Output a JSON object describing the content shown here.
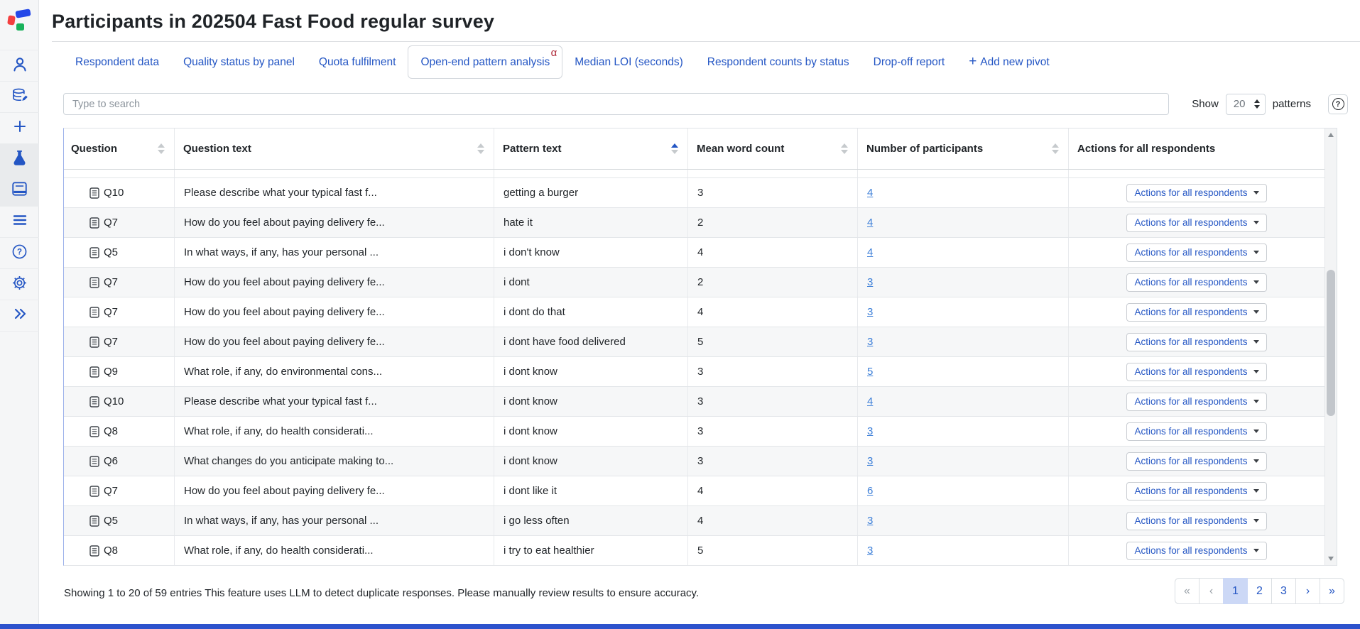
{
  "page": {
    "title": "Participants in 202504 Fast Food regular survey"
  },
  "sidebar": {
    "icons": [
      {
        "name": "user"
      },
      {
        "name": "database"
      },
      {
        "name": "add"
      },
      {
        "name": "flask",
        "active": true
      },
      {
        "name": "book",
        "active": true
      },
      {
        "name": "menu"
      },
      {
        "name": "help"
      },
      {
        "name": "settings"
      },
      {
        "name": "expand"
      }
    ]
  },
  "tabs": [
    {
      "label": "Respondent data"
    },
    {
      "label": "Quality status by panel"
    },
    {
      "label": "Quota fulfilment"
    },
    {
      "label": "Open-end pattern analysis",
      "active": true,
      "badge": "α"
    },
    {
      "label": "Median LOI (seconds)"
    },
    {
      "label": "Respondent counts by status"
    },
    {
      "label": "Drop-off report"
    },
    {
      "label": "Add new pivot",
      "icon": "plus"
    }
  ],
  "toolbar": {
    "search_placeholder": "Type to search",
    "show_label": "Show",
    "show_value": "20",
    "unit_label": "patterns",
    "help_icon": "?"
  },
  "table": {
    "columns": [
      {
        "label": "Question",
        "sortable": true,
        "sort": "none"
      },
      {
        "label": "Question text",
        "sortable": true,
        "sort": "none"
      },
      {
        "label": "Pattern text",
        "sortable": true,
        "sort": "asc"
      },
      {
        "label": "Mean word count",
        "sortable": true,
        "sort": "none"
      },
      {
        "label": "Number of participants",
        "sortable": true,
        "sort": "none"
      },
      {
        "label": "Actions for all respondents",
        "sortable": false,
        "sort": "none"
      }
    ],
    "action_button_label": "Actions for all respondents",
    "rows": [
      {
        "question": "Q10",
        "question_text": "Please describe what your typical fast f...",
        "pattern_text": "getting a burger",
        "mean_word_count": "3",
        "participants": "4"
      },
      {
        "question": "Q7",
        "question_text": "How do you feel about paying delivery fe...",
        "pattern_text": "hate it",
        "mean_word_count": "2",
        "participants": "4"
      },
      {
        "question": "Q5",
        "question_text": "In what ways, if any, has your personal ...",
        "pattern_text": "i don't know",
        "mean_word_count": "4",
        "participants": "4"
      },
      {
        "question": "Q7",
        "question_text": "How do you feel about paying delivery fe...",
        "pattern_text": "i dont",
        "mean_word_count": "2",
        "participants": "3"
      },
      {
        "question": "Q7",
        "question_text": "How do you feel about paying delivery fe...",
        "pattern_text": "i dont do that",
        "mean_word_count": "4",
        "participants": "3"
      },
      {
        "question": "Q7",
        "question_text": "How do you feel about paying delivery fe...",
        "pattern_text": "i dont have food delivered",
        "mean_word_count": "5",
        "participants": "3"
      },
      {
        "question": "Q9",
        "question_text": "What role, if any, do environmental cons...",
        "pattern_text": "i dont know",
        "mean_word_count": "3",
        "participants": "5"
      },
      {
        "question": "Q10",
        "question_text": "Please describe what your typical fast f...",
        "pattern_text": "i dont know",
        "mean_word_count": "3",
        "participants": "4"
      },
      {
        "question": "Q8",
        "question_text": "What role, if any, do health considerati...",
        "pattern_text": "i dont know",
        "mean_word_count": "3",
        "participants": "3"
      },
      {
        "question": "Q6",
        "question_text": "What changes do you anticipate making to...",
        "pattern_text": "i dont know",
        "mean_word_count": "3",
        "participants": "3"
      },
      {
        "question": "Q7",
        "question_text": "How do you feel about paying delivery fe...",
        "pattern_text": "i dont like it",
        "mean_word_count": "4",
        "participants": "6"
      },
      {
        "question": "Q5",
        "question_text": "In what ways, if any, has your personal ...",
        "pattern_text": "i go less often",
        "mean_word_count": "4",
        "participants": "3"
      },
      {
        "question": "Q8",
        "question_text": "What role, if any, do health considerati...",
        "pattern_text": "i try to eat healthier",
        "mean_word_count": "5",
        "participants": "3"
      }
    ]
  },
  "footer": {
    "showing_text": "Showing 1 to 20 of 59 entries",
    "note": "This feature uses LLM to detect duplicate responses. Please manually review results to ensure accuracy.",
    "pagination": {
      "first": "«",
      "prev": "‹",
      "pages": [
        "1",
        "2",
        "3"
      ],
      "active_page": "1",
      "next": "›",
      "last": "»"
    }
  },
  "colors": {
    "accent_blue": "#2456c4",
    "link_blue": "#3d7fd8",
    "alpha_red": "#b02d3c",
    "active_page_bg": "#ccd8f6",
    "bottom_bar_blue": "#2d52cc"
  }
}
